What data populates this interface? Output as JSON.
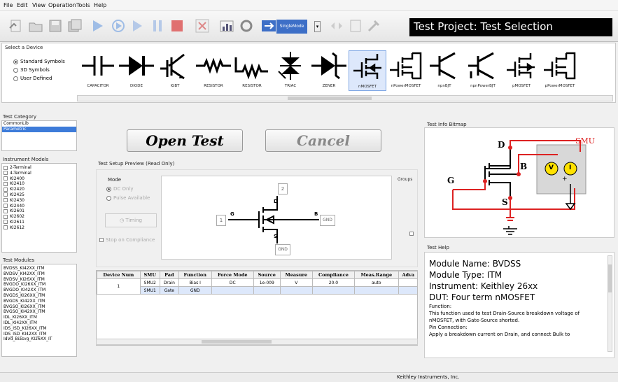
{
  "menu": [
    "File",
    "Edit",
    "View",
    "Operation",
    "Tools",
    "Help"
  ],
  "toolbar": {
    "single_mode_label": "SingleMode",
    "title": "Test Project: Test Selection"
  },
  "device_select": {
    "title": "Select a Device",
    "options": [
      "Standard Symbols",
      "3D Symbols",
      "User Defined"
    ],
    "devices": [
      "CAPACITOR",
      "DIODE",
      "IGBT",
      "RESISTOR",
      "RESISTOR",
      "TRIAC",
      "ZENER",
      "nMOSFET",
      "nPowerMOSFET",
      "npnBJT",
      "npnPowerBJT",
      "pMOSFET",
      "pPowerMOSFET"
    ],
    "selected": "nMOSFET"
  },
  "test_category": {
    "title": "Test Category",
    "items": [
      "CommonLib",
      "Parametric"
    ],
    "selected": "Parametric"
  },
  "instrument_models": {
    "title": "Instrument Models",
    "items": [
      "2-Terminal",
      "4-Terminal",
      "KI2400",
      "KI2410",
      "KI2420",
      "KI2425",
      "KI2430",
      "KI2440",
      "KI2601",
      "KI2602",
      "KI2611",
      "KI2612"
    ]
  },
  "test_modules": {
    "title": "Test Modules",
    "items": [
      "BVDSS_KI42XX_ITM",
      "BVDSV_KI42XX_ITM",
      "BVDSV_KI26XX_ITM",
      "BVGDO_KI26XX_ITM",
      "BVGDO_KI42XX_ITM",
      "BVGDS_KI26XX_ITM",
      "BVGDS_KI42XX_ITM",
      "BVGSO_KI26XX_ITM",
      "BVGSO_KI42XX_ITM",
      "IDL_KI26XX_ITM",
      "IDL_KI42XX_ITM",
      "IDS_ISD_KI26XX_ITM",
      "IDS_ISD_KI42XX_ITM",
      "IdVd_Biasvg_KI26XX_IT"
    ]
  },
  "buttons": {
    "open_test": "Open Test",
    "cancel": "Cancel"
  },
  "setup_preview": {
    "title": "Test Setup Preview (Read Only)",
    "mode_label": "Mode",
    "mode_options": [
      "DC Only",
      "Pulse Available"
    ],
    "timing": "Timing",
    "stop_on_compliance": "Stop on Compliance",
    "groups_label": "Groups",
    "pins": {
      "g": "G",
      "d": "D",
      "s": "S",
      "b": "B",
      "n1": "1",
      "n2": "2",
      "gnd": "GND"
    }
  },
  "grid": {
    "headers": [
      "Device Num",
      "SMU",
      "Pad",
      "Function",
      "Force Mode",
      "Source",
      "Measure",
      "Compliance",
      "Meas.Range",
      "Adva"
    ],
    "device_num": "1",
    "rows": [
      [
        "SMU2",
        "Drain",
        "Bias I",
        "DC",
        "1e-009",
        "V",
        "20.0",
        "auto"
      ],
      [
        "SMU1",
        "Gate",
        "GND",
        "",
        "",
        "",
        "",
        ""
      ]
    ]
  },
  "info_bitmap": {
    "title": "Test Info Bitmap",
    "smu": "SMU",
    "d": "D",
    "g": "G",
    "s": "S",
    "b": "B",
    "v": "V",
    "i": "I",
    "plus": "+"
  },
  "help": {
    "title": "Test Help",
    "module_name": "Module Name: BVDSS",
    "module_type": "Module Type: ITM",
    "instrument": "Instrument: Keithley 26xx",
    "dut": "DUT: Four term nMOSFET",
    "function_label": "Function:",
    "function_text": [
      "This function used to test Drain-Source breakdown voltage of",
      "nMOSFET, with Gate-Source shorted."
    ],
    "pin_label": "Pin Connection:",
    "pin_text": "Apply a breakdown current on Drain, and connect Bulk to"
  },
  "status": {
    "company": "Keithley Instruments, Inc."
  }
}
